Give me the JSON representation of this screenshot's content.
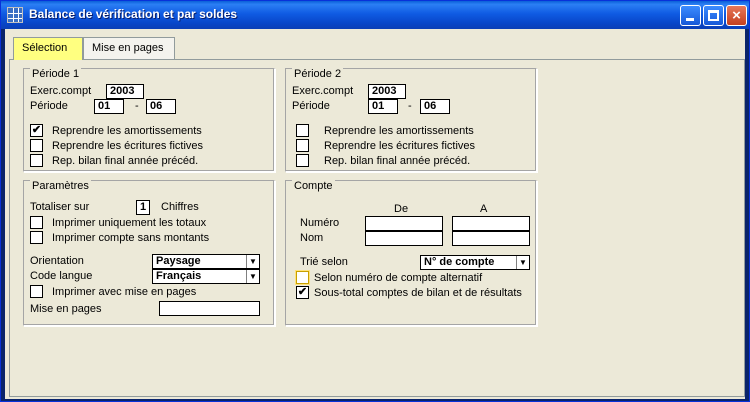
{
  "window": {
    "title": "Balance de vérification et par soldes",
    "close_glyph": "×"
  },
  "tabs": [
    {
      "label": "Sélection",
      "active": true
    },
    {
      "label": "Mise en pages",
      "active": false
    }
  ],
  "periode1": {
    "title": "Période 1",
    "exerc_label": "Exerc.compt",
    "exerc_value": "2003",
    "periode_label": "Période",
    "from": "01",
    "dash": "-",
    "to": "06",
    "options": [
      {
        "label": "Reprendre les amortissements",
        "checked": true,
        "mark": "✔"
      },
      {
        "label": "Reprendre les écritures fictives",
        "checked": false,
        "mark": ""
      },
      {
        "label": "Rep. bilan final année précéd.",
        "checked": false,
        "mark": ""
      }
    ]
  },
  "periode2": {
    "title": "Période 2",
    "exerc_label": "Exerc.compt",
    "exerc_value": "2003",
    "periode_label": "Période",
    "from": "01",
    "dash": "-",
    "to": "06",
    "options": [
      {
        "label": "Reprendre les amortissements",
        "checked": false,
        "mark": ""
      },
      {
        "label": "Reprendre les écritures fictives",
        "checked": false,
        "mark": ""
      },
      {
        "label": "Rep. bilan final année précéd.",
        "checked": false,
        "mark": ""
      }
    ]
  },
  "parametres": {
    "title": "Paramètres",
    "totaliser_label": "Totaliser sur",
    "totaliser_value": "1",
    "chiffres_label": "Chiffres",
    "opt_totaux": "Imprimer uniquement les totaux",
    "opt_sans_montants": "Imprimer compte sans montants",
    "orientation_label": "Orientation",
    "orientation_value": "Paysage",
    "langue_label": "Code langue",
    "langue_value": "Français",
    "opt_mise_en_pages": "Imprimer avec mise en pages",
    "mise_en_pages_label": "Mise en pages",
    "mise_en_pages_value": "",
    "arrow": "▼"
  },
  "compte": {
    "title": "Compte",
    "col_de": "De",
    "col_a": "A",
    "numero_label": "Numéro",
    "nom_label": "Nom",
    "numero_de": "",
    "numero_a": "",
    "nom_de": "",
    "nom_a": "",
    "trie_label": "Trié selon",
    "trie_value": "N° de compte",
    "opt_alternatif": "Selon numéro de compte alternatif",
    "opt_alternatif_mark": "",
    "opt_sous_total": "Sous-total comptes de bilan et de résultats",
    "opt_sous_total_mark": "✔",
    "arrow": "▼"
  }
}
